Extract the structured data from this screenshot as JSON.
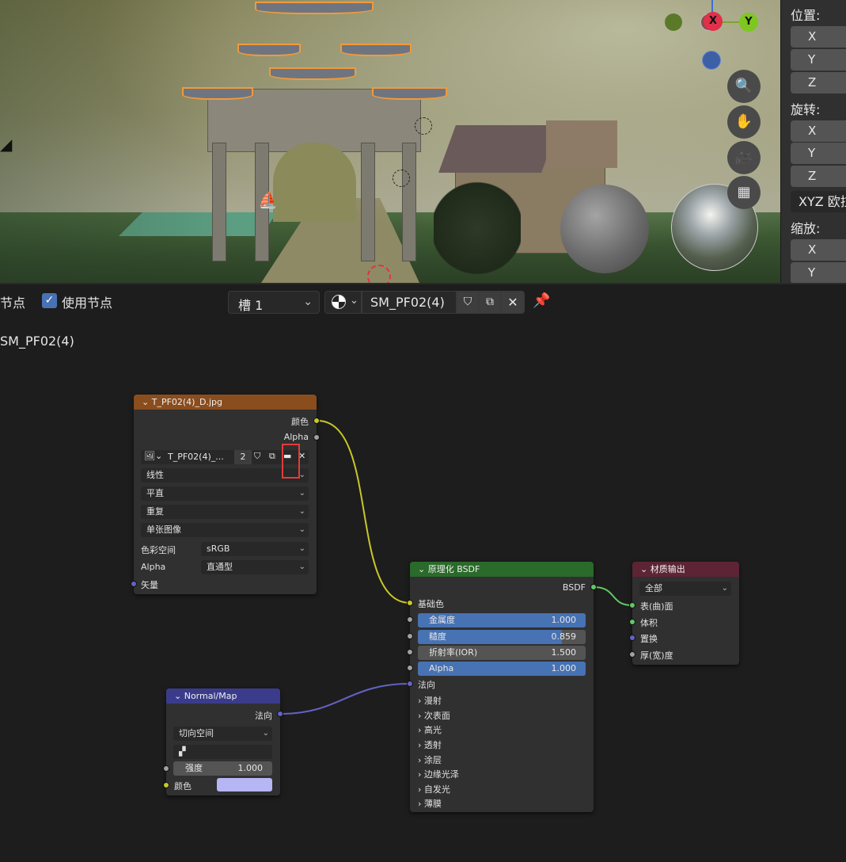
{
  "properties": {
    "location_label": "位置:",
    "rotation_label": "旋转:",
    "scale_label": "缩放:",
    "x": "X",
    "y": "Y",
    "z": "Z",
    "rotation_mode": "XYZ 欧拉"
  },
  "gizmo": {
    "x": "X",
    "y": "Y"
  },
  "header": {
    "nodes_menu": "节点",
    "use_nodes_label": "使用节点",
    "slot_value": "槽 1",
    "material_name": "SM_PF02(4)"
  },
  "breadcrumb": "SM_PF02(4)",
  "image_node": {
    "title": "T_PF02(4)_D.jpg",
    "out_color": "颜色",
    "out_alpha": "Alpha",
    "image_name": "T_PF02(4)_...",
    "users": "2",
    "interpolation": "线性",
    "projection": "平直",
    "extension": "重复",
    "source": "单张图像",
    "color_space_label": "色彩空间",
    "color_space_value": "sRGB",
    "alpha_label": "Alpha",
    "alpha_value": "直通型",
    "in_vector": "矢量"
  },
  "bsdf_node": {
    "title": "原理化 BSDF",
    "out_bsdf": "BSDF",
    "base_color": "基础色",
    "metallic_label": "金属度",
    "metallic_value": "1.000",
    "metallic_fill": 1.0,
    "roughness_label": "糙度",
    "roughness_value": "0.859",
    "roughness_fill": 0.859,
    "ior_label": "折射率(IOR)",
    "ior_value": "1.500",
    "alpha_label": "Alpha",
    "alpha_value": "1.000",
    "alpha_fill": 1.0,
    "normal": "法向",
    "panels": [
      "漫射",
      "次表面",
      "高光",
      "透射",
      "涂层",
      "边缘光泽",
      "自发光",
      "薄膜"
    ]
  },
  "output_node": {
    "title": "材质输出",
    "target": "全部",
    "surface": "表(曲)面",
    "volume": "体积",
    "displacement": "置换",
    "thickness": "厚(宽)度"
  },
  "normal_node": {
    "title": "Normal/Map",
    "out_normal": "法向",
    "space": "切向空间",
    "strength_label": "强度",
    "strength_value": "1.000",
    "color_label": "颜色",
    "color_swatch": "#b6b6f5"
  },
  "colors": {
    "image_header": "#8a4d1e",
    "bsdf_header": "#2a6a2a",
    "output_header": "#5c2434",
    "normal_header": "#3b3b8c",
    "accent": "#4772b3"
  }
}
